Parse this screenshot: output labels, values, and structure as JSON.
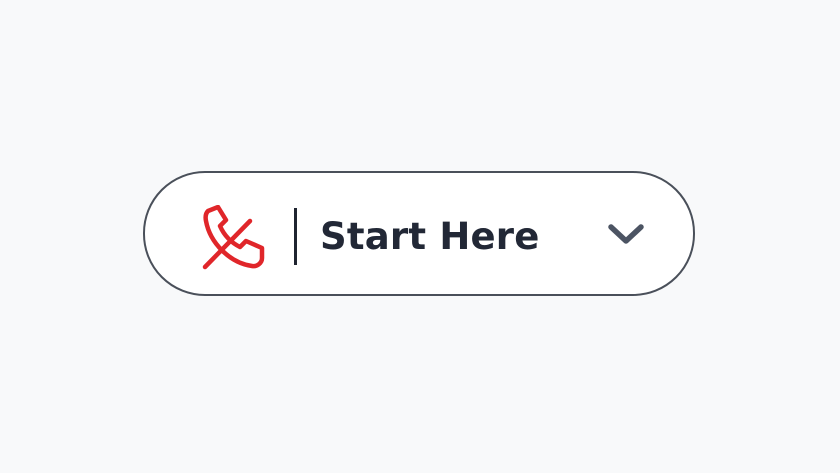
{
  "button": {
    "label": "Start Here"
  },
  "icons": {
    "leading": "phone-off-icon",
    "trailing": "chevron-down-icon"
  },
  "colors": {
    "icon_red": "#e0262a",
    "text": "#222836",
    "border": "#4a505a",
    "chevron": "#4c5463",
    "background": "#f8f9fa",
    "pill_fill": "#ffffff"
  }
}
